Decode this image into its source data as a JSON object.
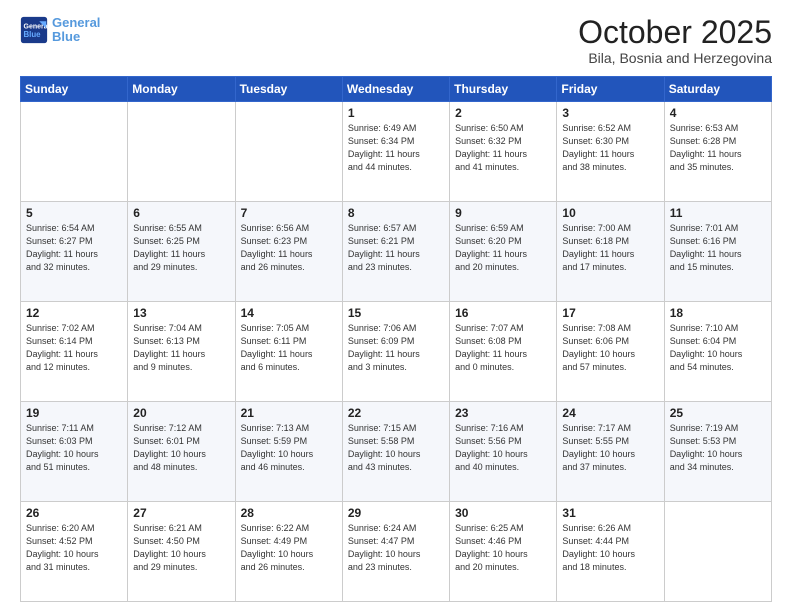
{
  "header": {
    "logo_line1": "General",
    "logo_line2": "Blue",
    "month": "October 2025",
    "location": "Bila, Bosnia and Herzegovina"
  },
  "days_of_week": [
    "Sunday",
    "Monday",
    "Tuesday",
    "Wednesday",
    "Thursday",
    "Friday",
    "Saturday"
  ],
  "weeks": [
    [
      {
        "day": "",
        "info": ""
      },
      {
        "day": "",
        "info": ""
      },
      {
        "day": "",
        "info": ""
      },
      {
        "day": "1",
        "info": "Sunrise: 6:49 AM\nSunset: 6:34 PM\nDaylight: 11 hours\nand 44 minutes."
      },
      {
        "day": "2",
        "info": "Sunrise: 6:50 AM\nSunset: 6:32 PM\nDaylight: 11 hours\nand 41 minutes."
      },
      {
        "day": "3",
        "info": "Sunrise: 6:52 AM\nSunset: 6:30 PM\nDaylight: 11 hours\nand 38 minutes."
      },
      {
        "day": "4",
        "info": "Sunrise: 6:53 AM\nSunset: 6:28 PM\nDaylight: 11 hours\nand 35 minutes."
      }
    ],
    [
      {
        "day": "5",
        "info": "Sunrise: 6:54 AM\nSunset: 6:27 PM\nDaylight: 11 hours\nand 32 minutes."
      },
      {
        "day": "6",
        "info": "Sunrise: 6:55 AM\nSunset: 6:25 PM\nDaylight: 11 hours\nand 29 minutes."
      },
      {
        "day": "7",
        "info": "Sunrise: 6:56 AM\nSunset: 6:23 PM\nDaylight: 11 hours\nand 26 minutes."
      },
      {
        "day": "8",
        "info": "Sunrise: 6:57 AM\nSunset: 6:21 PM\nDaylight: 11 hours\nand 23 minutes."
      },
      {
        "day": "9",
        "info": "Sunrise: 6:59 AM\nSunset: 6:20 PM\nDaylight: 11 hours\nand 20 minutes."
      },
      {
        "day": "10",
        "info": "Sunrise: 7:00 AM\nSunset: 6:18 PM\nDaylight: 11 hours\nand 17 minutes."
      },
      {
        "day": "11",
        "info": "Sunrise: 7:01 AM\nSunset: 6:16 PM\nDaylight: 11 hours\nand 15 minutes."
      }
    ],
    [
      {
        "day": "12",
        "info": "Sunrise: 7:02 AM\nSunset: 6:14 PM\nDaylight: 11 hours\nand 12 minutes."
      },
      {
        "day": "13",
        "info": "Sunrise: 7:04 AM\nSunset: 6:13 PM\nDaylight: 11 hours\nand 9 minutes."
      },
      {
        "day": "14",
        "info": "Sunrise: 7:05 AM\nSunset: 6:11 PM\nDaylight: 11 hours\nand 6 minutes."
      },
      {
        "day": "15",
        "info": "Sunrise: 7:06 AM\nSunset: 6:09 PM\nDaylight: 11 hours\nand 3 minutes."
      },
      {
        "day": "16",
        "info": "Sunrise: 7:07 AM\nSunset: 6:08 PM\nDaylight: 11 hours\nand 0 minutes."
      },
      {
        "day": "17",
        "info": "Sunrise: 7:08 AM\nSunset: 6:06 PM\nDaylight: 10 hours\nand 57 minutes."
      },
      {
        "day": "18",
        "info": "Sunrise: 7:10 AM\nSunset: 6:04 PM\nDaylight: 10 hours\nand 54 minutes."
      }
    ],
    [
      {
        "day": "19",
        "info": "Sunrise: 7:11 AM\nSunset: 6:03 PM\nDaylight: 10 hours\nand 51 minutes."
      },
      {
        "day": "20",
        "info": "Sunrise: 7:12 AM\nSunset: 6:01 PM\nDaylight: 10 hours\nand 48 minutes."
      },
      {
        "day": "21",
        "info": "Sunrise: 7:13 AM\nSunset: 5:59 PM\nDaylight: 10 hours\nand 46 minutes."
      },
      {
        "day": "22",
        "info": "Sunrise: 7:15 AM\nSunset: 5:58 PM\nDaylight: 10 hours\nand 43 minutes."
      },
      {
        "day": "23",
        "info": "Sunrise: 7:16 AM\nSunset: 5:56 PM\nDaylight: 10 hours\nand 40 minutes."
      },
      {
        "day": "24",
        "info": "Sunrise: 7:17 AM\nSunset: 5:55 PM\nDaylight: 10 hours\nand 37 minutes."
      },
      {
        "day": "25",
        "info": "Sunrise: 7:19 AM\nSunset: 5:53 PM\nDaylight: 10 hours\nand 34 minutes."
      }
    ],
    [
      {
        "day": "26",
        "info": "Sunrise: 6:20 AM\nSunset: 4:52 PM\nDaylight: 10 hours\nand 31 minutes."
      },
      {
        "day": "27",
        "info": "Sunrise: 6:21 AM\nSunset: 4:50 PM\nDaylight: 10 hours\nand 29 minutes."
      },
      {
        "day": "28",
        "info": "Sunrise: 6:22 AM\nSunset: 4:49 PM\nDaylight: 10 hours\nand 26 minutes."
      },
      {
        "day": "29",
        "info": "Sunrise: 6:24 AM\nSunset: 4:47 PM\nDaylight: 10 hours\nand 23 minutes."
      },
      {
        "day": "30",
        "info": "Sunrise: 6:25 AM\nSunset: 4:46 PM\nDaylight: 10 hours\nand 20 minutes."
      },
      {
        "day": "31",
        "info": "Sunrise: 6:26 AM\nSunset: 4:44 PM\nDaylight: 10 hours\nand 18 minutes."
      },
      {
        "day": "",
        "info": ""
      }
    ]
  ]
}
